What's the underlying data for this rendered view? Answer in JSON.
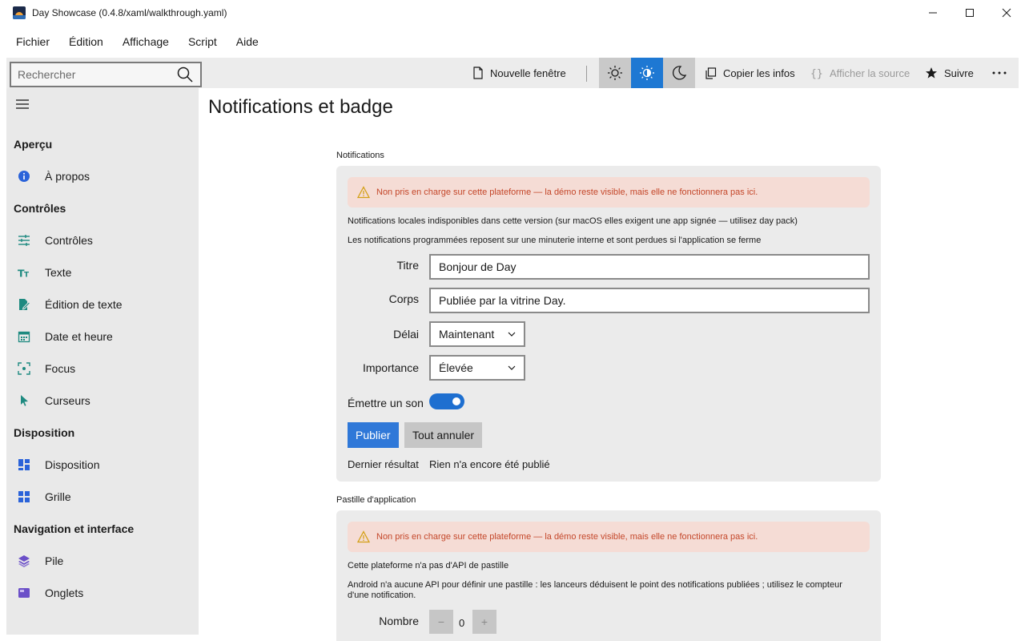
{
  "window": {
    "title": "Day Showcase (0.4.8/xaml/walkthrough.yaml)"
  },
  "menu": [
    "Fichier",
    "Édition",
    "Affichage",
    "Script",
    "Aide"
  ],
  "toolbar": {
    "search_placeholder": "Rechercher",
    "new_window": "Nouvelle fenêtre",
    "copy_info": "Copier les infos",
    "show_source": "Afficher la source",
    "follow": "Suivre",
    "theme_active": "system",
    "accent_color": "#1e78d3"
  },
  "sidebar": {
    "sections": [
      {
        "title": "Aperçu",
        "items": [
          {
            "label": "À propos",
            "icon": "info-icon"
          }
        ]
      },
      {
        "title": "Contrôles",
        "items": [
          {
            "label": "Contrôles",
            "icon": "sliders-icon"
          },
          {
            "label": "Texte",
            "icon": "text-icon"
          },
          {
            "label": "Édition de texte",
            "icon": "edit-doc-icon"
          },
          {
            "label": "Date et heure",
            "icon": "calendar-icon"
          },
          {
            "label": "Focus",
            "icon": "focus-icon"
          },
          {
            "label": "Curseurs",
            "icon": "cursor-icon"
          }
        ]
      },
      {
        "title": "Disposition",
        "items": [
          {
            "label": "Disposition",
            "icon": "layout-icon"
          },
          {
            "label": "Grille",
            "icon": "grid-icon"
          }
        ]
      },
      {
        "title": "Navigation et interface",
        "items": [
          {
            "label": "Pile",
            "icon": "stack-icon"
          },
          {
            "label": "Onglets",
            "icon": "tabs-icon"
          }
        ]
      }
    ]
  },
  "main": {
    "title": "Notifications et badge",
    "notifications": {
      "section_label": "Notifications",
      "warning": "Non pris en charge sur cette plateforme — la démo reste visible, mais elle ne fonctionnera pas ici.",
      "info1": "Notifications locales indisponibles dans cette version (sur macOS elles exigent une app signée — utilisez day pack)",
      "info2": "Les notifications programmées reposent sur une minuterie interne et sont perdues si l'application se ferme",
      "title_label": "Titre",
      "title_value": "Bonjour de Day",
      "body_label": "Corps",
      "body_value": "Publiée par la vitrine Day.",
      "delay_label": "Délai",
      "delay_value": "Maintenant",
      "importance_label": "Importance",
      "importance_value": "Élevée",
      "sound_label": "Émettre un son",
      "sound_on": true,
      "publish": "Publier",
      "cancel_all": "Tout annuler",
      "last_result_label": "Dernier résultat",
      "last_result_value": "Rien n'a encore été publié"
    },
    "badge": {
      "section_label": "Pastille d'application",
      "warning": "Non pris en charge sur cette plateforme — la démo reste visible, mais elle ne fonctionnera pas ici.",
      "info1": "Cette plateforme n'a pas d'API de pastille",
      "info2": "Android n'a aucune API pour définir une pastille : les lanceurs déduisent le point des notifications publiées ; utilisez le compteur d'une notification.",
      "count_label": "Nombre",
      "count_value": "0",
      "minus": "−",
      "plus": "+"
    }
  }
}
